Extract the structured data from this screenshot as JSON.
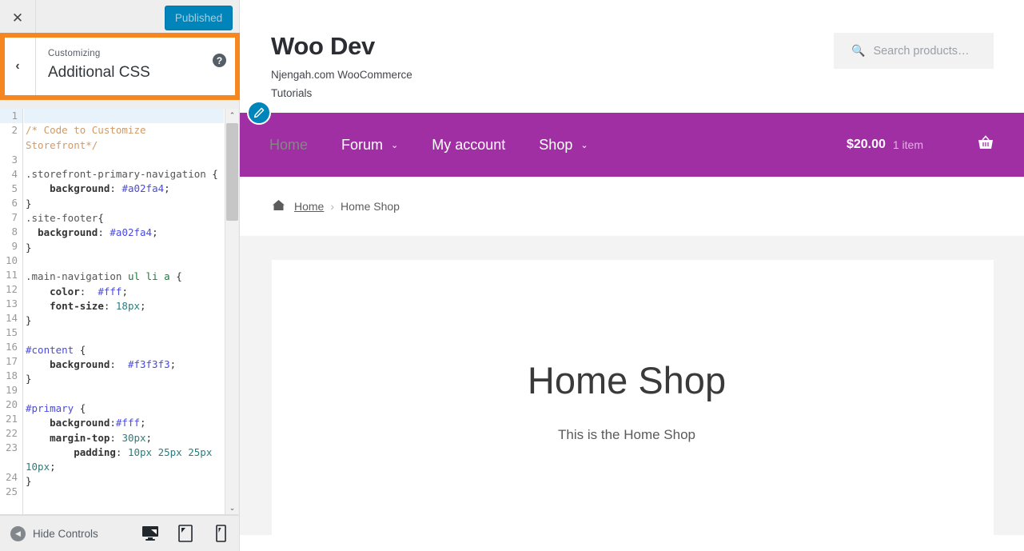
{
  "customizer": {
    "close_label": "✕",
    "publish_label": "Published",
    "back_label": "‹",
    "eyebrow": "Customizing",
    "title": "Additional CSS",
    "help_label": "?",
    "hide_controls_label": "Hide Controls",
    "hide_controls_icon": "collapse-arrow-icon",
    "devices": [
      {
        "name": "desktop",
        "label": "Desktop"
      },
      {
        "name": "tablet",
        "label": "Tablet"
      },
      {
        "name": "mobile",
        "label": "Mobile"
      }
    ],
    "scrollbar": {
      "up_arrow": "⌃",
      "down_arrow": "⌄"
    },
    "highlight_color": "#f6861f",
    "publish_color": "#0085ba"
  },
  "editor": {
    "line_numbers": [
      "1",
      "2",
      "3",
      "4",
      "5",
      "6",
      "7",
      "8",
      "9",
      "10",
      "11",
      "12",
      "13",
      "14",
      "15",
      "16",
      "17",
      "18",
      "19",
      "20",
      "21",
      "22",
      "23",
      "24",
      "25"
    ],
    "lines": [
      "",
      "/* Code to Customize Storefront*/",
      "",
      ".storefront-primary-navigation {",
      "    background: #a02fa4;",
      "}",
      ".site-footer{",
      "  background: #a02fa4;",
      "}",
      "",
      ".main-navigation ul li a {",
      "    color:  #fff;",
      "    font-size: 18px;",
      "}",
      "",
      "#content {",
      "    background:  #f3f3f3;",
      "}",
      "",
      "#primary {",
      "    background:#fff;",
      "    margin-top: 30px;",
      "        padding: 10px 25px 25px 10px;",
      "}",
      ""
    ],
    "active_line": 1
  },
  "preview": {
    "site": {
      "title": "Woo Dev",
      "description": "Njengah.com WooCommerce Tutorials"
    },
    "search": {
      "placeholder": "Search products…",
      "icon": "search-icon",
      "value": ""
    },
    "nav": {
      "edit_shortcut_icon": "pencil-icon",
      "items": [
        {
          "label": "Home",
          "has_caret": false,
          "current": true
        },
        {
          "label": "Forum",
          "has_caret": true,
          "current": false
        },
        {
          "label": "My account",
          "has_caret": false,
          "current": false
        },
        {
          "label": "Shop",
          "has_caret": true,
          "current": false
        }
      ],
      "caret": "⌄",
      "background_color": "#a02fa4"
    },
    "cart": {
      "amount": "$20.00",
      "count": "1 item",
      "icon": "shopping-basket-icon"
    },
    "breadcrumb": {
      "home_icon": "home-icon",
      "home_label": "Home",
      "separator": "›",
      "current": "Home Shop"
    },
    "page": {
      "title": "Home Shop",
      "subtitle": "This is the Home Shop",
      "content_background": "#f3f3f3",
      "primary_background": "#ffffff"
    }
  }
}
